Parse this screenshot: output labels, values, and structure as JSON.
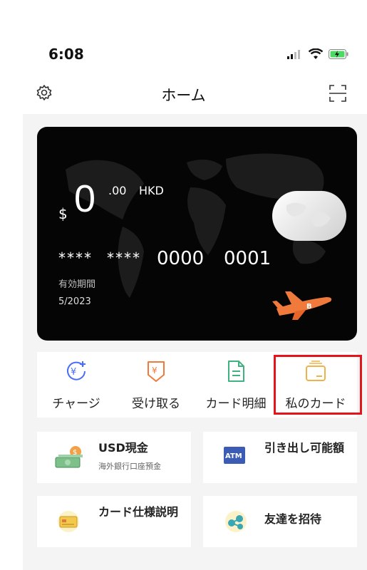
{
  "status_bar": {
    "time": "6:08"
  },
  "nav": {
    "title": "ホーム"
  },
  "card": {
    "currency_symbol": "$",
    "balance_integer": "0",
    "balance_decimal": ".00",
    "currency": "HKD",
    "masked_1": "****",
    "masked_2": "****",
    "group_3": "0000",
    "group_4": "0001",
    "expiry_label": "有効期間",
    "expiry_value": "5/2023"
  },
  "actions": [
    {
      "label": "チャージ",
      "icon": "charge-yen-icon"
    },
    {
      "label": "受け取る",
      "icon": "receive-yen-icon"
    },
    {
      "label": "カード明細",
      "icon": "statement-document-icon"
    },
    {
      "label": "私のカード",
      "icon": "wallet-card-icon"
    }
  ],
  "tiles": [
    {
      "title": "USD現金",
      "subtitle": "海外銀行口座預金",
      "icon": "cash-bills-icon"
    },
    {
      "title": "引き出し可能額",
      "subtitle": "",
      "icon": "atm-icon"
    },
    {
      "title": "カード仕様説明",
      "subtitle": "",
      "icon": "card-info-icon"
    },
    {
      "title": "友達を招待",
      "subtitle": "",
      "icon": "invite-friends-icon"
    }
  ],
  "colors": {
    "highlight": "#e3141b",
    "charge": "#4a6cf7",
    "receive": "#f07a3c",
    "statement": "#3fb27f",
    "wallet": "#f0b04a"
  }
}
